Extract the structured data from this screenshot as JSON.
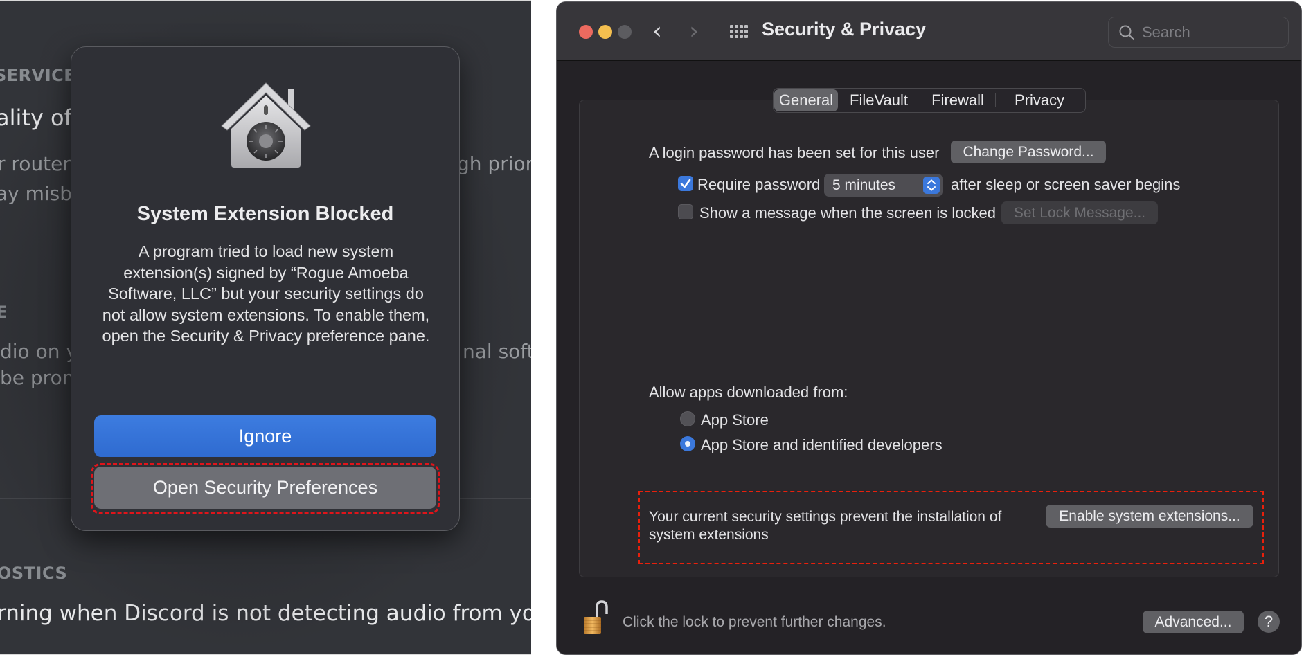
{
  "left_panel": {
    "background_app": {
      "section_headers": [
        "SERVICE",
        "E",
        "OSTICS"
      ],
      "title_fragment": "ality of S",
      "body_fragments": {
        "service_line1_left": "r router t",
        "service_line1_right": "gh priori",
        "service_line2_left": "ay misbe",
        "audio_line1_left": "dio on y",
        "audio_line1_right": "nal softw",
        "audio_line2_left": "be prom",
        "diagnostics_line": "rning when Discord is not detecting audio from your m"
      }
    },
    "dialog": {
      "icon": "security-house-vault-icon",
      "title": "System Extension Blocked",
      "body": "A program tried to load new system extension(s) signed by “Rogue Amoeba Software, LLC” but your security settings do not allow system extensions. To enable them, open the Security & Privacy preference pane.",
      "primary_button": "Ignore",
      "secondary_button": "Open Security Preferences",
      "highlight_color": "#e0141a"
    }
  },
  "right_panel": {
    "window": {
      "title": "Security & Privacy",
      "traffic_lights": {
        "close": "#ec6a5f",
        "minimize": "#f4bf4f",
        "zoom": "#5c5c60"
      },
      "nav_back": "‹",
      "nav_forward": "›",
      "search": {
        "placeholder": "Search",
        "value": ""
      }
    },
    "tabs": [
      {
        "label": "General",
        "active": true
      },
      {
        "label": "FileVault",
        "active": false
      },
      {
        "label": "Firewall",
        "active": false
      },
      {
        "label": "Privacy",
        "active": false
      }
    ],
    "general": {
      "login_password_text": "A login password has been set for this user",
      "change_password_button": "Change Password...",
      "require_password": {
        "checked": true,
        "label": "Require password",
        "delay": "5 minutes",
        "suffix": "after sleep or screen saver begins"
      },
      "show_message": {
        "checked": false,
        "label": "Show a message when the screen is locked",
        "button": "Set Lock Message...",
        "button_enabled": false
      },
      "allow_apps_label": "Allow apps downloaded from:",
      "allow_apps_options": [
        {
          "label": "App Store",
          "selected": false
        },
        {
          "label": "App Store and identified developers",
          "selected": true
        }
      ],
      "extensions_notice": "Your current security settings prevent the installation of system extensions",
      "enable_extensions_button": "Enable system extensions...",
      "highlight_color": "#e8200c"
    },
    "footer": {
      "lock_icon": "unlocked-padlock-icon",
      "lock_text": "Click the lock to prevent further changes.",
      "advanced_button": "Advanced...",
      "help_button": "?"
    },
    "accent_color": "#3b78dc"
  }
}
